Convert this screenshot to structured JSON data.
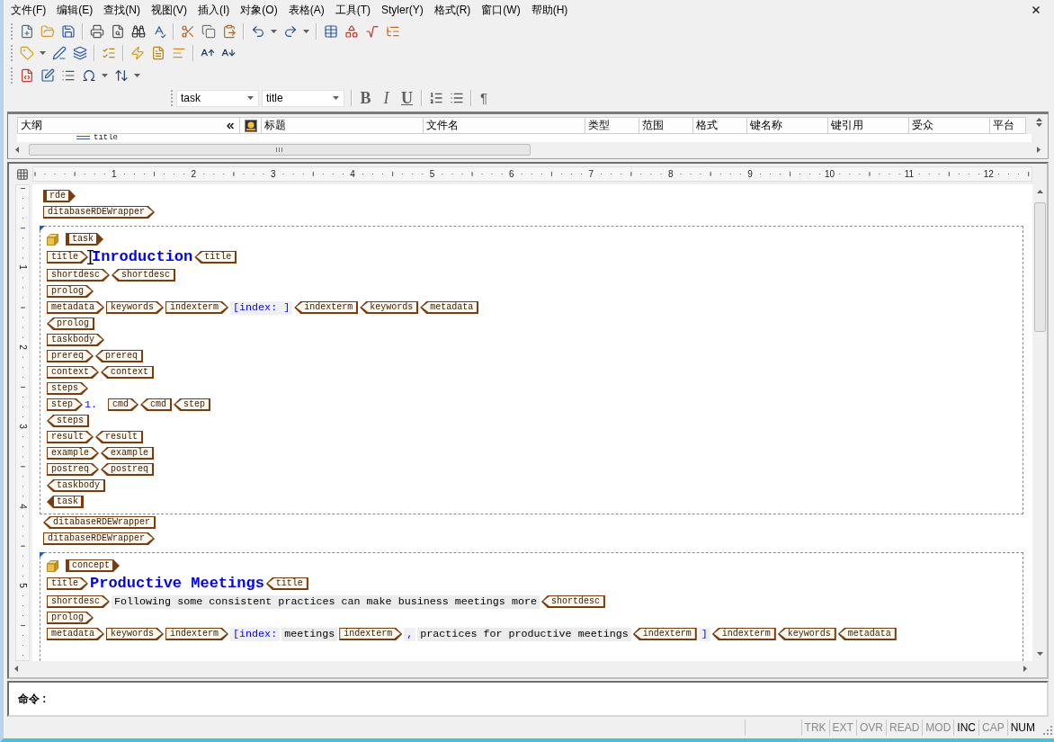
{
  "menu_bar": {
    "items": [
      "文件(F)",
      "编辑(E)",
      "查找(N)",
      "视图(V)",
      "插入(I)",
      "对象(O)",
      "表格(A)",
      "工具(T)",
      "Styler(Y)",
      "格式(R)",
      "窗口(W)",
      "帮助(H)"
    ]
  },
  "format_toolbar": {
    "dropdowns": [
      "task",
      "title"
    ],
    "buttons": [
      {
        "label": "B",
        "kind": "bold"
      },
      {
        "label": "I",
        "kind": "italic"
      },
      {
        "label": "U",
        "kind": "underline"
      }
    ],
    "paragraph_mark": "¶"
  },
  "outline": {
    "header": "大纲",
    "columns": [
      "标题",
      "文件名",
      "类型",
      "范围",
      "格式",
      "键名称",
      "键引用",
      "受众",
      "平台"
    ],
    "rows": [
      {
        "label": "title"
      }
    ]
  },
  "ruler": {
    "horizontal": [
      "1",
      "2",
      "3",
      "4",
      "5",
      "6",
      "7",
      "8",
      "9",
      "10",
      "11",
      "12"
    ],
    "vertical": [
      "1",
      "2",
      "3",
      "4",
      "5"
    ]
  },
  "document": [
    {
      "kind": "line",
      "segments": [
        {
          "kind": "start",
          "label": "rde",
          "filled": true
        }
      ]
    },
    {
      "kind": "line",
      "segments": [
        {
          "kind": "start",
          "label": "ditabaseRDEWrapper",
          "filled": false
        }
      ]
    },
    {
      "kind": "block",
      "lines": [
        {
          "segments": [
            {
              "kind": "start",
              "label": "task",
              "filled": true
            }
          ]
        },
        {
          "segments": [
            {
              "kind": "start",
              "label": "title",
              "filled": false
            },
            {
              "kind": "cursor"
            },
            {
              "kind": "title",
              "label": "Inroduction"
            },
            {
              "kind": "end",
              "label": "title",
              "filled": false
            }
          ]
        },
        {
          "segments": [
            {
              "kind": "start",
              "label": "shortdesc",
              "filled": false
            },
            {
              "kind": "end",
              "label": "shortdesc",
              "filled": false
            }
          ]
        },
        {
          "segments": [
            {
              "kind": "start",
              "label": "prolog",
              "filled": false
            }
          ]
        },
        {
          "segments": [
            {
              "kind": "start",
              "label": "metadata",
              "filled": false
            },
            {
              "kind": "start",
              "label": "keywords",
              "filled": false
            },
            {
              "kind": "start",
              "label": "indexterm",
              "filled": false
            },
            {
              "kind": "index",
              "label": "[index: ]"
            },
            {
              "kind": "end",
              "label": "indexterm",
              "filled": false
            },
            {
              "kind": "end",
              "label": "keywords",
              "filled": false
            },
            {
              "kind": "end",
              "label": "metadata",
              "filled": false
            }
          ]
        },
        {
          "segments": [
            {
              "kind": "end",
              "label": "prolog",
              "filled": false
            }
          ]
        },
        {
          "segments": [
            {
              "kind": "start",
              "label": "taskbody",
              "filled": false
            }
          ]
        },
        {
          "segments": [
            {
              "kind": "start",
              "label": "prereq",
              "filled": false
            },
            {
              "kind": "end",
              "label": "prereq",
              "filled": false
            }
          ]
        },
        {
          "segments": [
            {
              "kind": "start",
              "label": "context",
              "filled": false
            },
            {
              "kind": "end",
              "label": "context",
              "filled": false
            }
          ]
        },
        {
          "segments": [
            {
              "kind": "start",
              "label": "steps",
              "filled": false
            }
          ]
        },
        {
          "segments": [
            {
              "kind": "start",
              "label": "step",
              "filled": false
            },
            {
              "kind": "number",
              "label": "1."
            },
            {
              "kind": "start",
              "label": "cmd",
              "filled": false
            },
            {
              "kind": "end",
              "label": "cmd",
              "filled": false
            },
            {
              "kind": "end",
              "label": "step",
              "filled": false
            }
          ]
        },
        {
          "segments": [
            {
              "kind": "end",
              "label": "steps",
              "filled": false
            }
          ]
        },
        {
          "segments": [
            {
              "kind": "start",
              "label": "result",
              "filled": false
            },
            {
              "kind": "end",
              "label": "result",
              "filled": false
            }
          ]
        },
        {
          "segments": [
            {
              "kind": "start",
              "label": "example",
              "filled": false
            },
            {
              "kind": "end",
              "label": "example",
              "filled": false
            }
          ]
        },
        {
          "segments": [
            {
              "kind": "start",
              "label": "postreq",
              "filled": false
            },
            {
              "kind": "end",
              "label": "postreq",
              "filled": false
            }
          ]
        },
        {
          "segments": [
            {
              "kind": "end",
              "label": "taskbody",
              "filled": false
            }
          ]
        },
        {
          "segments": [
            {
              "kind": "end",
              "label": "task",
              "filled": true
            }
          ]
        }
      ]
    },
    {
      "kind": "line",
      "segments": [
        {
          "kind": "end",
          "label": "ditabaseRDEWrapper",
          "filled": false
        }
      ]
    },
    {
      "kind": "line",
      "segments": [
        {
          "kind": "start",
          "label": "ditabaseRDEWrapper",
          "filled": false
        }
      ]
    },
    {
      "kind": "block",
      "lines": [
        {
          "segments": [
            {
              "kind": "start",
              "label": "concept",
              "filled": true
            }
          ]
        },
        {
          "segments": [
            {
              "kind": "start",
              "label": "title",
              "filled": false
            },
            {
              "kind": "title",
              "label": "Productive Meetings"
            },
            {
              "kind": "end",
              "label": "title",
              "filled": false
            }
          ]
        },
        {
          "segments": [
            {
              "kind": "start",
              "label": "shortdesc",
              "filled": false
            },
            {
              "kind": "text",
              "label": "Following some consistent practices can make business meetings more"
            },
            {
              "kind": "end",
              "label": "shortdesc",
              "filled": false
            }
          ]
        },
        {
          "segments": [
            {
              "kind": "start",
              "label": "prolog",
              "filled": false
            }
          ]
        },
        {
          "segments": [
            {
              "kind": "start",
              "label": "metadata",
              "filled": false
            },
            {
              "kind": "start",
              "label": "keywords",
              "filled": false
            },
            {
              "kind": "start",
              "label": "indexterm",
              "filled": false
            },
            {
              "kind": "index",
              "label": "[index:"
            },
            {
              "kind": "text",
              "label": "meetings"
            },
            {
              "kind": "start",
              "label": "indexterm",
              "filled": false
            },
            {
              "kind": "index",
              "label": ","
            },
            {
              "kind": "text",
              "label": "practices for productive meetings"
            },
            {
              "kind": "end",
              "label": "indexterm",
              "filled": false
            },
            {
              "kind": "index",
              "label": "]"
            },
            {
              "kind": "end",
              "label": "indexterm",
              "filled": false
            },
            {
              "kind": "end",
              "label": "keywords",
              "filled": false
            },
            {
              "kind": "end",
              "label": "metadata",
              "filled": false
            }
          ]
        }
      ]
    }
  ],
  "command_bar": {
    "label": "命令 :"
  },
  "status_bar": {
    "indicators": [
      {
        "label": "TRK",
        "on": false
      },
      {
        "label": "EXT",
        "on": false
      },
      {
        "label": "OVR",
        "on": false
      },
      {
        "label": "READ",
        "on": false
      },
      {
        "label": "MOD",
        "on": false
      },
      {
        "label": "INC",
        "on": true
      },
      {
        "label": "CAP",
        "on": false
      },
      {
        "label": "NUM",
        "on": true
      }
    ]
  }
}
